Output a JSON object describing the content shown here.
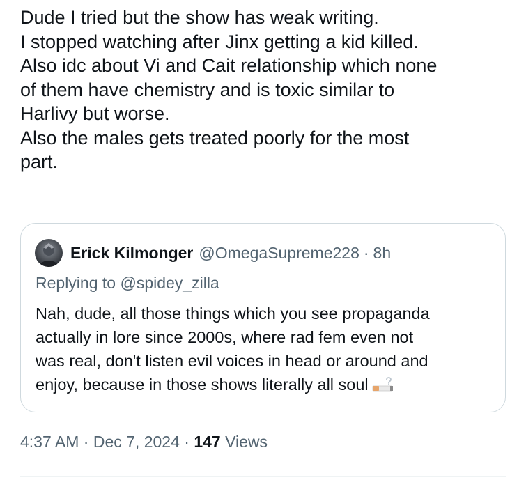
{
  "tweet": {
    "lines": [
      "Dude I tried but the show has weak writing.",
      "I stopped watching after Jinx getting a kid killed.",
      "Also idc about Vi and Cait relationship which none",
      "of them have chemistry and is toxic similar to",
      "Harlivy but worse.",
      "Also the males gets treated poorly for the most",
      "part."
    ]
  },
  "quote": {
    "author_name": "Erick Kilmonger",
    "author_handle": "@OmegaSupreme228",
    "separator": "·",
    "time_ago": "8h",
    "replying_prefix": "Replying to",
    "replying_handle": "@spidey_zilla",
    "lines": [
      "Nah, dude, all those things which you see propaganda",
      "actually in lore since 2000s, where rad fem even not",
      "was real, don't listen evil voices in head or around and",
      "enjoy, because in those shows literally all soul"
    ],
    "avatar_icon": "user-avatar",
    "emoji_icon": "cigarette-question-emoji"
  },
  "meta": {
    "time": "4:37 AM",
    "separator": "·",
    "date": "Dec 7, 2024",
    "views_count": "147",
    "views_label": "Views"
  },
  "colors": {
    "text_primary": "#0f1419",
    "text_secondary": "#536471",
    "border": "#cfd9de",
    "divider": "#eff3f4",
    "background": "#ffffff"
  }
}
